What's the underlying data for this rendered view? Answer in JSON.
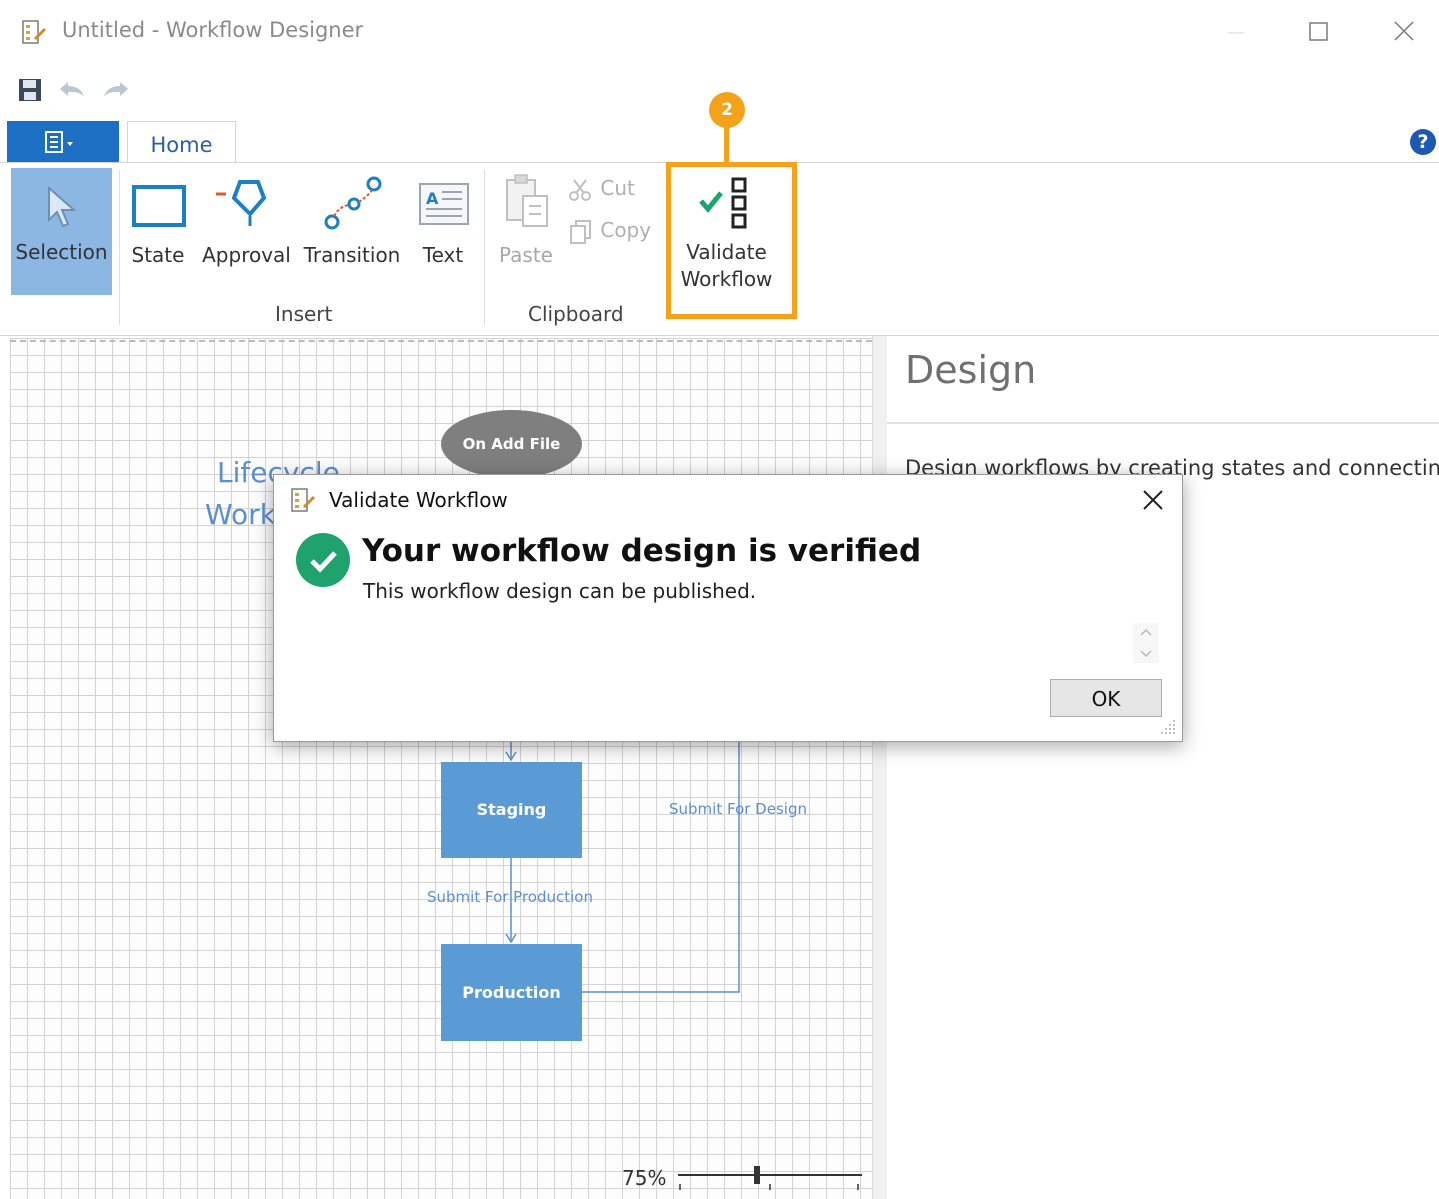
{
  "window": {
    "title": "Untitled - Workflow Designer",
    "controls": [
      "minimize",
      "maximize",
      "close"
    ]
  },
  "quick_access": {
    "icons": [
      "save-icon",
      "undo-icon",
      "redo-icon"
    ]
  },
  "ribbon": {
    "tabs": [
      {
        "label": "Home",
        "active": true
      }
    ],
    "help": "?",
    "groups": {
      "insert": {
        "label": "Insert",
        "buttons": [
          {
            "label": "Selection",
            "icon": "cursor-icon",
            "active": true
          },
          {
            "label": "State",
            "icon": "state-icon"
          },
          {
            "label": "Approval",
            "icon": "approval-icon"
          },
          {
            "label": "Transition",
            "icon": "transition-icon"
          },
          {
            "label": "Text",
            "icon": "text-icon"
          }
        ]
      },
      "clipboard": {
        "label": "Clipboard",
        "paste": "Paste",
        "cut": "Cut",
        "copy": "Copy"
      },
      "validate": {
        "label_line1": "Validate",
        "label_line2": "Workflow"
      }
    }
  },
  "annotation": {
    "step_number": "2",
    "highlight_color": "#f5a21b"
  },
  "canvas": {
    "title_fragment_1": "Lifecycle",
    "title_fragment_2": "Work",
    "nodes": {
      "start": "On Add File",
      "staging": "Staging",
      "production": "Production"
    },
    "edges": {
      "submit_for_design": "Submit For Design",
      "submit_for_production": "Submit For Production"
    },
    "zoom": "75%"
  },
  "design_panel": {
    "title": "Design",
    "description": "Design workflows by creating states and connecting"
  },
  "dialog": {
    "title": "Validate Workflow",
    "heading": "Your workflow design is verified",
    "message": "This workflow design can be published.",
    "ok_label": "OK",
    "status_color": "#1fa36e"
  },
  "colors": {
    "accent": "#1d6fc4",
    "node": "#5b9bd5",
    "start_node": "#7f7f7f"
  }
}
